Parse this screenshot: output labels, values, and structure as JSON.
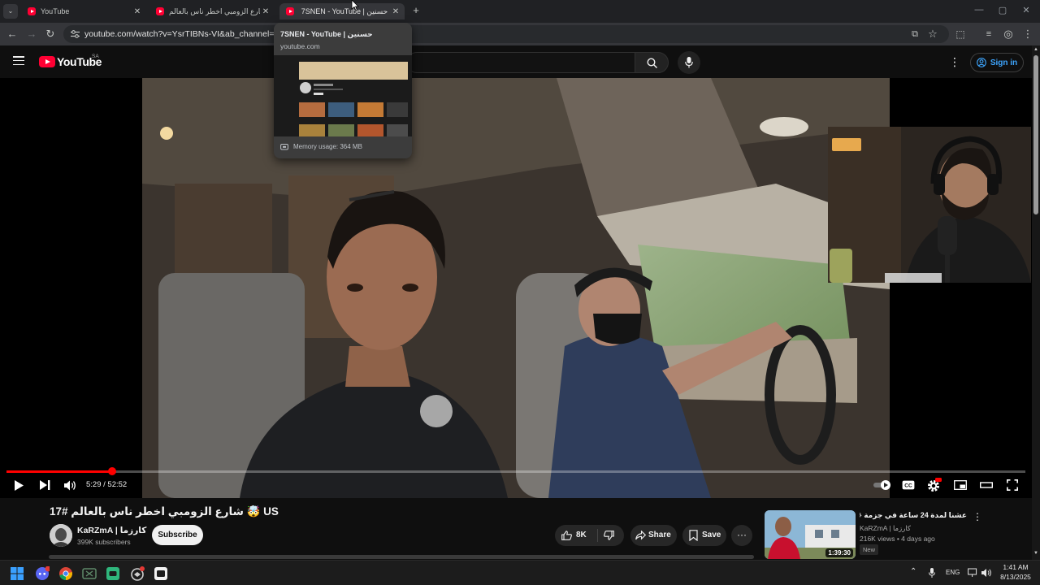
{
  "browser": {
    "tabs": [
      {
        "title": "YouTube",
        "active": false
      },
      {
        "title": "شارع الزومبي اخطر ناس بالعالم #",
        "active": false
      },
      {
        "title": "7SNEN - YouTube | حسنين",
        "active": true
      }
    ],
    "url": "youtube.com/watch?v=YsrTIBNs-VI&ab_channel=5%زاكرزما"
  },
  "hover_card": {
    "title": "7SNEN - YouTube | حسنين",
    "domain": "youtube.com",
    "memory": "Memory usage: 364 MB"
  },
  "masthead": {
    "logo_text": "YouTube",
    "region": "SA",
    "sign_in": "Sign in"
  },
  "player": {
    "time": "5:29 / 52:52",
    "progress": 0.104
  },
  "video": {
    "title": "17# شارع الزومبي اخطر ناس بالعالم 🤯 US",
    "channel": "KaRZmA | كارزما",
    "subscribers": "399K subscribers",
    "subscribe_label": "Subscribe",
    "likes": "8K",
    "share_label": "Share",
    "save_label": "Save"
  },
  "recommendation": {
    "title": "عشنا لمدة 24 ساعة في جزمة 😂 !#15",
    "channel": "KaRZmA | كارزما",
    "meta": "216K views • 4 days ago",
    "badge": "New",
    "duration": "1:39:30"
  },
  "taskbar": {
    "lang": "ENG",
    "time": "1:41 AM",
    "date": "8/13/2025"
  },
  "colors": {
    "youtube_red": "#ff0033",
    "progress_red": "#ff0000",
    "link_blue": "#3ea6ff"
  }
}
